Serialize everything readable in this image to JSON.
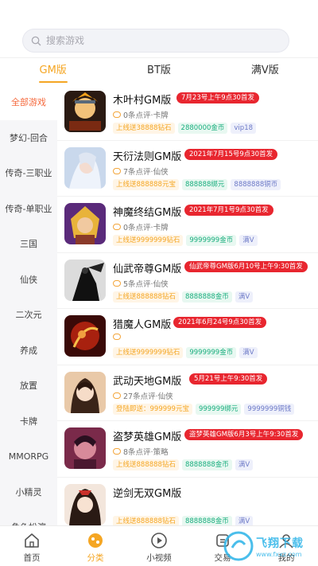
{
  "search": {
    "placeholder": "搜索游戏"
  },
  "tabs": [
    {
      "label": "GM版",
      "active": true
    },
    {
      "label": "BT版",
      "active": false
    },
    {
      "label": "满V版",
      "active": false
    }
  ],
  "sidebar": {
    "items": [
      {
        "label": "全部游戏",
        "active": true
      },
      {
        "label": "梦幻-回合"
      },
      {
        "label": "传奇-三职业"
      },
      {
        "label": "传奇-单职业"
      },
      {
        "label": "三国"
      },
      {
        "label": "仙侠"
      },
      {
        "label": "二次元"
      },
      {
        "label": "养成"
      },
      {
        "label": "放置"
      },
      {
        "label": "卡牌"
      },
      {
        "label": "MMORPG"
      },
      {
        "label": "小精灵"
      },
      {
        "label": "角色扮演"
      }
    ]
  },
  "games": [
    {
      "name": "木叶村GM版",
      "date": "7月23号上午9点30首发",
      "meta": "0条点评·卡牌",
      "tags": [
        "上线送38888钻石",
        "2880000金币",
        "vip18"
      ]
    },
    {
      "name": "天衍法则GM版",
      "date": "2021年7月15号9点30首发",
      "meta": "7条点评·仙侠",
      "tags": [
        "上线送888888元宝",
        "888888绑元",
        "8888888铜币"
      ]
    },
    {
      "name": "神魔终结GM版",
      "date": "2021年7月1号9点30首发",
      "meta": "0条点评·卡牌",
      "tags": [
        "上线送9999999钻石",
        "9999999金币",
        "满V"
      ]
    },
    {
      "name": "仙武帝尊GM版",
      "date": "仙武帝尊GM版6月10号上午9:30首发",
      "meta": "5条点评·仙侠",
      "tags": [
        "上线送888888钻石",
        "8888888金币",
        "满V"
      ]
    },
    {
      "name": "猎魔人GM版",
      "date": "2021年6月24号9点30首发",
      "meta": "",
      "tags": [
        "上线送9999999钻石",
        "9999999金币",
        "满V"
      ]
    },
    {
      "name": "武动天地GM版",
      "date": "5月21号上午9:30首发",
      "meta": "27条点评·仙侠",
      "tags": [
        "登陆即送：999999元宝",
        "999999绑元",
        "9999999铜钱"
      ]
    },
    {
      "name": "盗梦英雄GM版",
      "date": "盗梦英雄GM版6月3号上午9:30首发",
      "meta": "8条点评·策略",
      "tags": [
        "上线送888888钻石",
        "8888888金币",
        "满V"
      ]
    },
    {
      "name": "逆剑无双GM版",
      "date": "",
      "meta": "",
      "tags": [
        "上线送888888钻石",
        "8888888金币",
        "满V"
      ]
    }
  ],
  "bottom_nav": [
    {
      "label": "首页",
      "icon": "home-icon"
    },
    {
      "label": "分类",
      "icon": "category-icon",
      "active": true
    },
    {
      "label": "小视频",
      "icon": "play-icon"
    },
    {
      "label": "交易",
      "icon": "trade-icon"
    },
    {
      "label": "我的",
      "icon": "user-icon"
    }
  ],
  "watermark": {
    "text": "飞翔下载",
    "url": "www.fxxz.com"
  },
  "colors": {
    "accent": "#f5a623",
    "date_badge": "#e8262f",
    "sidebar_active": "#f56a3e"
  }
}
